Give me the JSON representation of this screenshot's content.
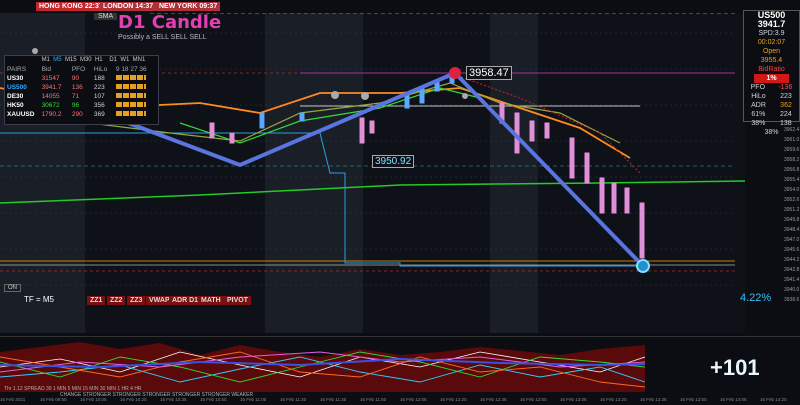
{
  "sessions": {
    "hongkong": "HONG KONG 22:37",
    "london": "LONDON 14:37",
    "newyork": "NEW YORK 09:37"
  },
  "brand": {
    "name": "D1 Candle",
    "slogan": "Possibly a SELL SELL SELL",
    "sma_label": "SMA"
  },
  "callouts": {
    "high": "3958.47",
    "low": "3950.92",
    "percent": "4.22%",
    "big_score": "+101",
    "tf": "TF = M5",
    "on": "ON"
  },
  "tabs": [
    "ZZ1",
    "ZZ2",
    "ZZ3",
    "VWAP",
    "ADR D1",
    "MATH",
    "PIVOT"
  ],
  "pairs_table": {
    "header_tf": [
      "M1",
      "M5",
      "M15",
      "M30",
      "H1",
      "D1",
      "W1",
      "MN1"
    ],
    "header_cols": [
      "PAIRS",
      "Bid",
      "PFO",
      "HiLo",
      "9",
      "18",
      "27",
      "36"
    ],
    "rows": [
      {
        "pair": "US30",
        "bid": "31547",
        "pfo": "90",
        "hilo": "188"
      },
      {
        "pair": "US500",
        "bid": "3941.7",
        "pfo": "136",
        "hilo": "223"
      },
      {
        "pair": "DE30",
        "bid": "14055",
        "pfo": "71",
        "hilo": "107"
      },
      {
        "pair": "HK50",
        "bid": "30672",
        "pfo": "96",
        "hilo": "356"
      },
      {
        "pair": "XAUUSD",
        "bid": "1790.2",
        "pfo": "290",
        "hilo": "369"
      }
    ]
  },
  "side_panel": {
    "symbol": "US500",
    "price": "3941.7",
    "spread": "SPD:3.9",
    "timer": "00:02:07",
    "open_label": "Open",
    "open_value": "3955.4",
    "bidratio_label": "BidRatio",
    "bidratio": "1%",
    "pfo_label": "PFO",
    "pfo": "-136",
    "hilo_label": "HiLo",
    "hilo": "223",
    "adr_label": "ADR",
    "adr": "362",
    "pct1_label": "61%",
    "pct1": "224",
    "pct2_label": "38%",
    "pct2": "138",
    "pct3": "38%"
  },
  "price_levels": [
    "3962.4",
    "3961.0",
    "3959.6",
    "3958.2",
    "3956.8",
    "3955.4",
    "3954.0",
    "3952.6",
    "3951.2",
    "3949.8",
    "3948.4",
    "3947.0",
    "3945.6",
    "3944.2",
    "3942.8",
    "3941.4",
    "3940.0",
    "3938.6"
  ],
  "osc_footer": "Thr 1.12   SPREAD 39   1 MIN  5 MIN  15 MIN  30 MIN  1 HR  4 HR",
  "osc_footer2": "CHANGE  STRONGER  STRONGER  STRONGER  STRONGER  STRONGER  WEAKER",
  "x_axis": [
    "16 Feb 2021",
    "16 Feb 09:50",
    "16 Feb 10:05",
    "16 Feb 10:20",
    "16 Feb 10:35",
    "16 Feb 10:50",
    "16 Feb 11:05",
    "16 Feb 11:20",
    "16 Feb 11:35",
    "16 Feb 11:50",
    "16 Feb 12:05",
    "16 Feb 12:20",
    "16 Feb 12:35",
    "16 Feb 12:50",
    "16 Feb 13:05",
    "16 Feb 13:20",
    "16 Feb 13:35",
    "16 Feb 13:50",
    "16 Feb 14:05",
    "16 Feb 14:20"
  ]
}
